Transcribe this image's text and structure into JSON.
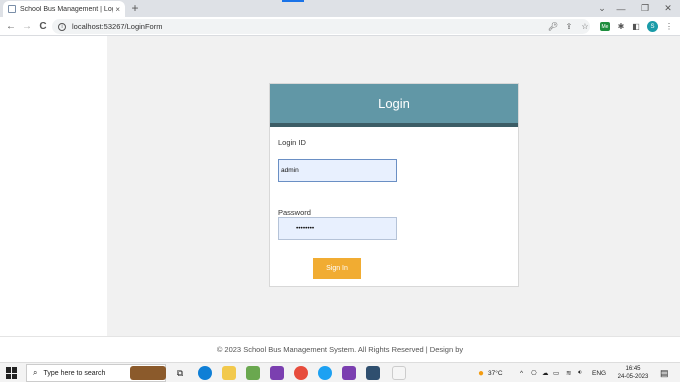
{
  "browser": {
    "tab_title": "School Bus Management | Login",
    "tab_close": "×",
    "new_tab": "+",
    "url": "localhost:53267/LoginForm",
    "back": "←",
    "forward": "→",
    "reload": "C",
    "minimize": "—",
    "restore": "❐",
    "close": "✕",
    "chevron": "⌄",
    "ext_label": "Me",
    "profile_initial": "S"
  },
  "login": {
    "header": "Login",
    "loginid_label": "Login ID",
    "loginid_value": "admin",
    "password_label": "Password",
    "password_value": "••••••••",
    "signin_label": "Sign In"
  },
  "footer": {
    "text": "© 2023 School Bus Management System. All Rights Reserved | Design by"
  },
  "taskbar": {
    "search_placeholder": "Type here to search",
    "weather": "37°C",
    "lang": "ENG",
    "time": "16:45",
    "date": "24-05-2023"
  },
  "colors": {
    "header": "#6197a6",
    "header_bar": "#3c5d66",
    "button": "#f1ac32"
  }
}
